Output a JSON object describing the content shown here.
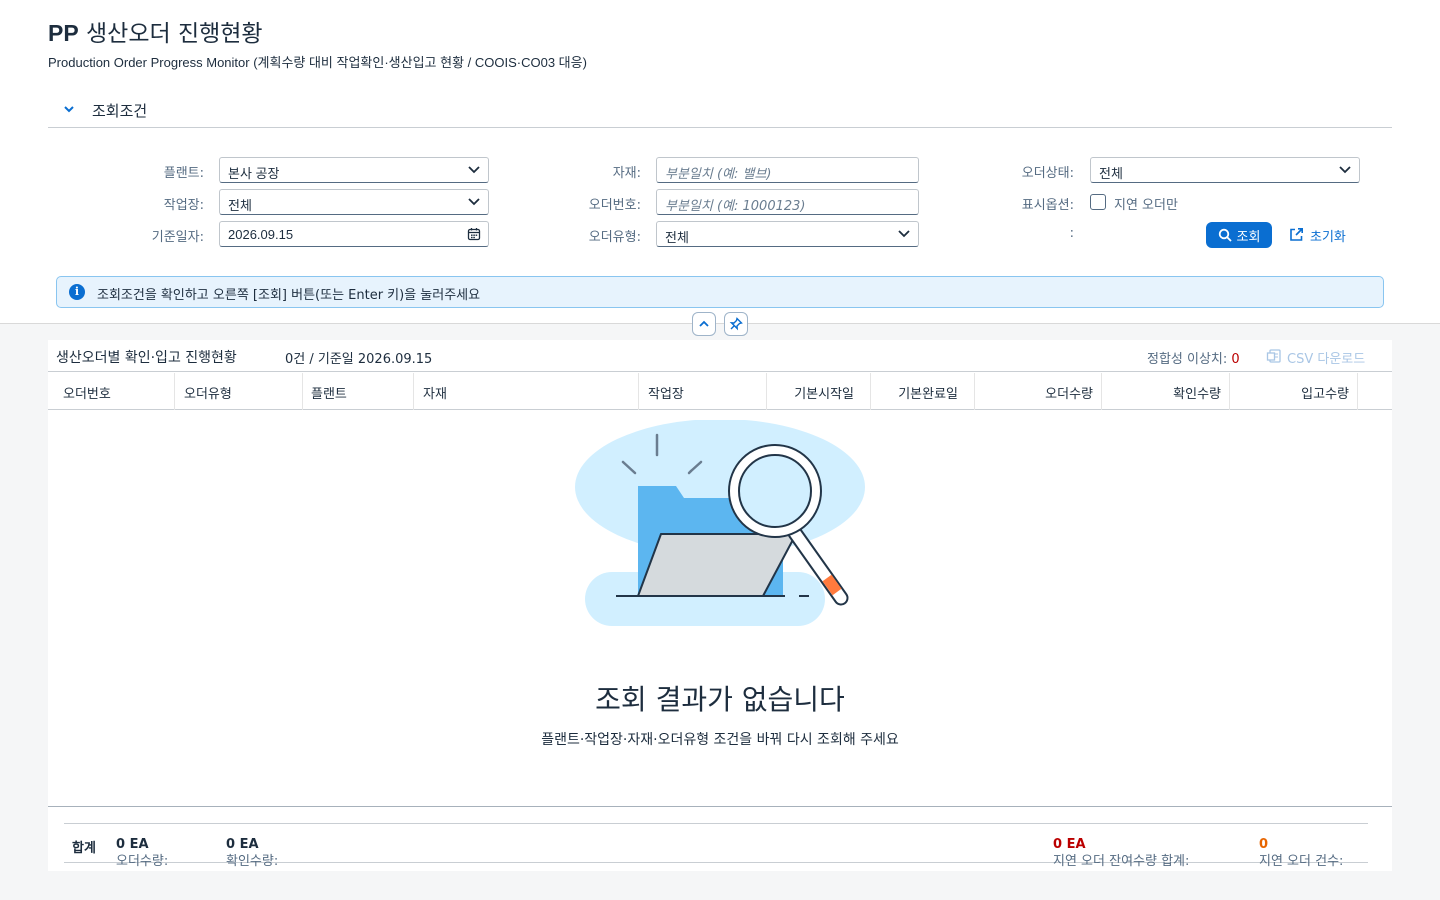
{
  "header": {
    "title_prefix": "PP",
    "title_rest": "생산오더 진행현황",
    "subtitle": "Production Order Progress Monitor (계획수량 대비 작업확인·생산입고 현황 / COOIS·CO03 대응)"
  },
  "filters": {
    "section_label": "조회조건",
    "plant_label": "플랜트:",
    "plant_value": "본사 공장",
    "workcenter_label": "작업장:",
    "workcenter_value": "전체",
    "date_label": "기준일자:",
    "date_value": "2026.09.15",
    "material_label": "자재:",
    "material_placeholder": "부분일치 (예: 밸브)",
    "order_no_label": "오더번호:",
    "order_no_placeholder": "부분일치 (예: 1000123)",
    "order_type_label": "오더유형:",
    "order_type_value": "전체",
    "order_status_label": "오더상태:",
    "order_status_value": "전체",
    "display_option_label": "표시옵션:",
    "delayed_only_label": "지연 오더만",
    "blank_label": ":",
    "search_button": "조회",
    "reset_button": "초기화"
  },
  "message": {
    "icon": "info-icon",
    "text": "조회조건을 확인하고 오른쪽 [조회] 버튼(또는 Enter 키)을 눌러주세요"
  },
  "table": {
    "title": "생산오더별 확인·입고 진행현황",
    "count_text": "0건 / 기준일 2026.09.15",
    "mismatch_label": "정합성 이상치:",
    "mismatch_value": "0",
    "csv_button": "CSV 다운로드",
    "columns": [
      "오더번호",
      "오더유형",
      "플랜트",
      "자재",
      "작업장",
      "기본시작일",
      "기본완료일",
      "오더수량",
      "확인수량",
      "입고수량"
    ],
    "rows": []
  },
  "empty_state": {
    "title": "조회 결과가 없습니다",
    "subtitle": "플랜트·작업장·자재·오더유형 조건을 바꿔 다시 조회해 주세요"
  },
  "footer": {
    "total_label": "합계",
    "order_qty_label": "오더수량:",
    "order_qty_value": "0 EA",
    "confirm_qty_label": "확인수량:",
    "confirm_qty_value": "0 EA",
    "delay_remaining_label": "지연 오더 잔여수량 합계:",
    "delay_remaining_value": "0 EA",
    "delay_count_label": "지연 오더 건수:",
    "delay_count_value": "0"
  },
  "colors": {
    "accent": "#0a6ed1",
    "error": "#bb0000",
    "warning": "#e76500",
    "info_bg": "#e7f3fd"
  }
}
